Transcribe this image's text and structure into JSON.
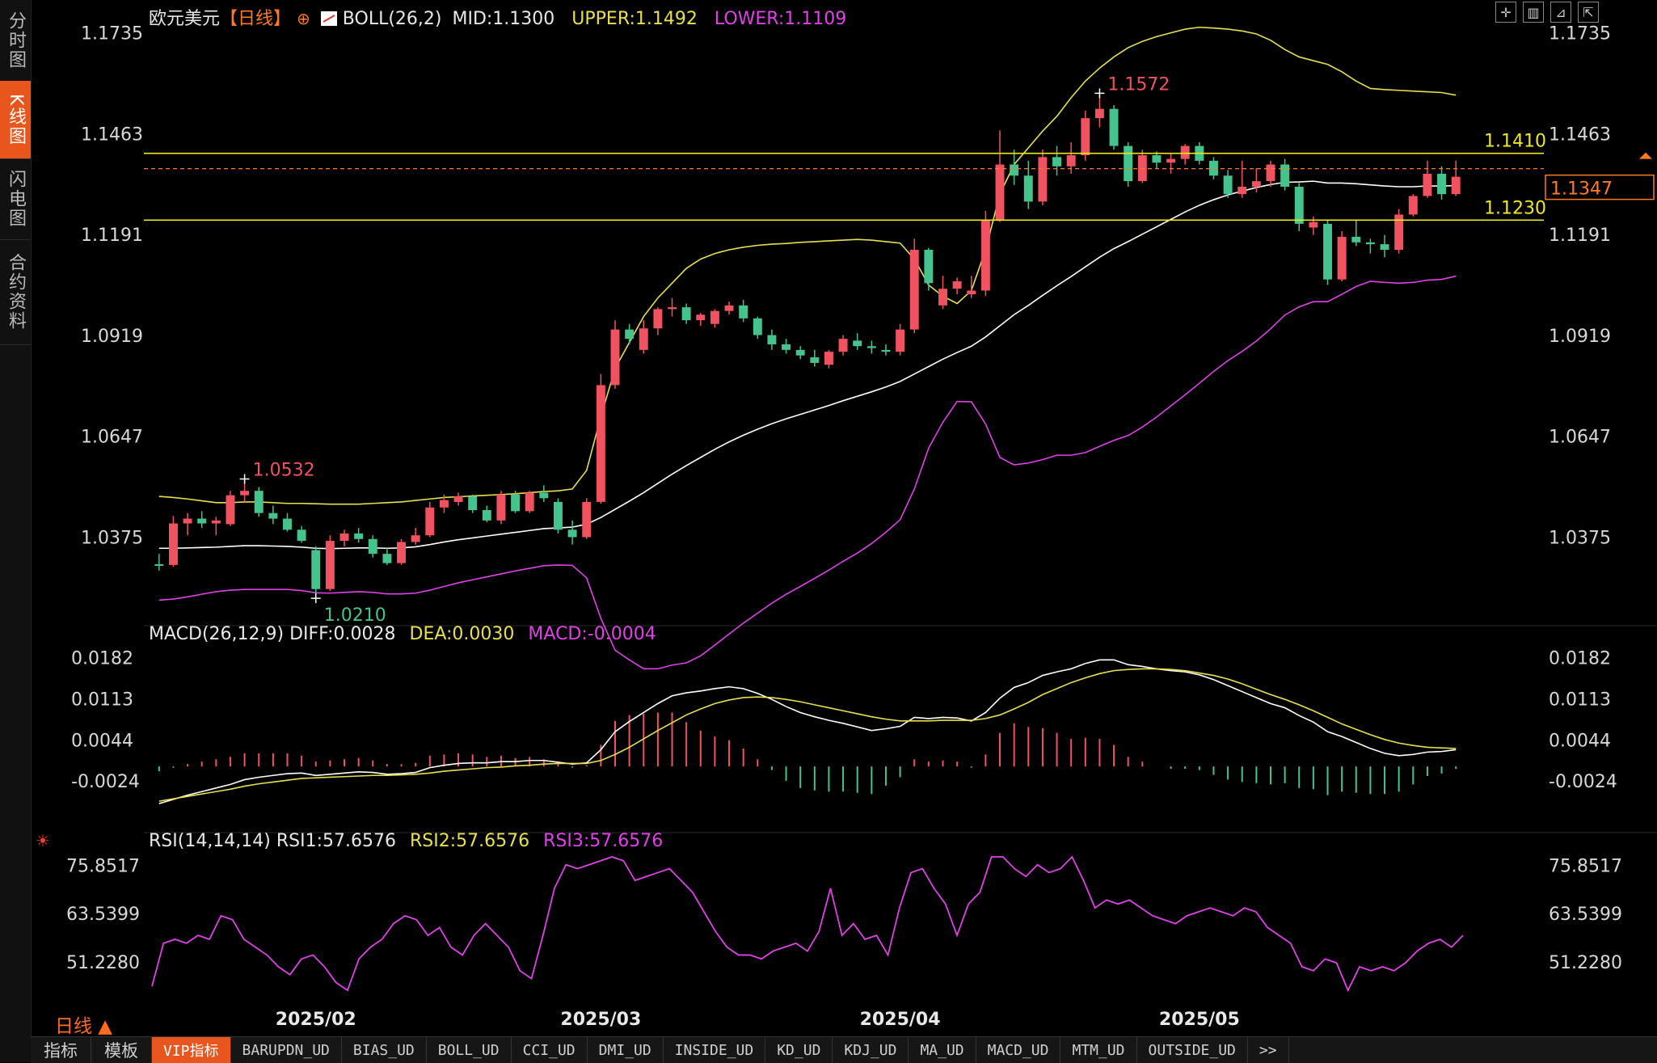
{
  "left_tabs": [
    {
      "label": "分时图",
      "active": false
    },
    {
      "label": "K线图",
      "active": true
    },
    {
      "label": "闪电图",
      "active": false
    },
    {
      "label": "合约资料",
      "active": false
    }
  ],
  "header": {
    "symbol": "欧元美元",
    "period_tag": "【日线】",
    "boll": {
      "name": "BOLL(26,2)",
      "mid": "MID:1.1300",
      "upper": "UPPER:1.1492",
      "lower": "LOWER:1.1109"
    },
    "toolbar_icons": [
      "crosshair-icon",
      "bar-chart-icon",
      "line-chart-icon",
      "expand-icon"
    ]
  },
  "macd_header": {
    "name": "MACD(26,12,9)",
    "diff": "DIFF:0.0028",
    "dea": "DEA:0.0030",
    "macd": "MACD:-0.0004"
  },
  "rsi_header": {
    "name": "RSI(14,14,14)",
    "rsi1": "RSI1:57.6576",
    "rsi2": "RSI2:57.6576",
    "rsi3": "RSI3:57.6576"
  },
  "colors": {
    "up": "#f0525f",
    "down": "#45c38c",
    "boll_mid": "#ffffff",
    "boll_upper": "#e8e04a",
    "boll_lower": "#e040e8",
    "price_line": "#ff7a1e",
    "level": "#f0e81e"
  },
  "chart_data": {
    "type": "candlestick",
    "title": "欧元美元 日线",
    "price_ticks": [
      "1.1735",
      "1.1463",
      "1.1191",
      "1.0919",
      "1.0647",
      "1.0375"
    ],
    "price_range": [
      1.0145,
      1.178
    ],
    "macd_ticks": [
      "0.0182",
      "0.0113",
      "0.0044",
      "-0.0024"
    ],
    "macd_range": [
      -0.007,
      0.02
    ],
    "rsi_ticks": [
      "75.8517",
      "63.5399",
      "51.2280"
    ],
    "rsi_range": [
      43,
      78
    ],
    "date_labels": [
      {
        "index": 11,
        "label": "2025/02"
      },
      {
        "index": 31,
        "label": "2025/03"
      },
      {
        "index": 52,
        "label": "2025/04"
      },
      {
        "index": 73,
        "label": "2025/05"
      }
    ],
    "annotations": [
      {
        "index": 6,
        "price": 1.0532,
        "label": "1.0532",
        "kind": "high"
      },
      {
        "index": 11,
        "price": 1.021,
        "label": "1.0210",
        "kind": "low"
      },
      {
        "index": 66,
        "price": 1.1572,
        "label": "1.1572",
        "kind": "high"
      }
    ],
    "levels": [
      {
        "price": 1.141,
        "label": "1.1410"
      },
      {
        "price": 1.123,
        "label": "1.1230"
      }
    ],
    "last_price": {
      "price": 1.1347,
      "label": "1.1347"
    },
    "candles": [
      [
        1.0302,
        1.033,
        1.0285,
        1.03
      ],
      [
        1.03,
        1.0432,
        1.0295,
        1.0412
      ],
      [
        1.0412,
        1.044,
        1.038,
        1.0425
      ],
      [
        1.0425,
        1.0445,
        1.04,
        1.0412
      ],
      [
        1.0412,
        1.043,
        1.038,
        1.042
      ],
      [
        1.041,
        1.05,
        1.0405,
        1.0488
      ],
      [
        1.0488,
        1.0532,
        1.047,
        1.05
      ],
      [
        1.05,
        1.051,
        1.043,
        1.044
      ],
      [
        1.044,
        1.046,
        1.041,
        1.0425
      ],
      [
        1.0425,
        1.044,
        1.039,
        1.0395
      ],
      [
        1.0395,
        1.0405,
        1.036,
        1.0365
      ],
      [
        1.034,
        1.035,
        1.021,
        1.0235
      ],
      [
        1.0235,
        1.038,
        1.023,
        1.0365
      ],
      [
        1.0365,
        1.0395,
        1.035,
        1.0385
      ],
      [
        1.0385,
        1.04,
        1.036,
        1.037
      ],
      [
        1.037,
        1.038,
        1.032,
        1.033
      ],
      [
        1.033,
        1.0345,
        1.03,
        1.0305
      ],
      [
        1.0305,
        1.037,
        1.03,
        1.0362
      ],
      [
        1.0362,
        1.04,
        1.0355,
        1.038
      ],
      [
        1.038,
        1.047,
        1.0375,
        1.0455
      ],
      [
        1.0455,
        1.049,
        1.044,
        1.0475
      ],
      [
        1.047,
        1.0495,
        1.046,
        1.0485
      ],
      [
        1.0485,
        1.049,
        1.044,
        1.0448
      ],
      [
        1.0448,
        1.046,
        1.0415,
        1.042
      ],
      [
        1.042,
        1.05,
        1.041,
        1.049
      ],
      [
        1.049,
        1.05,
        1.044,
        1.0445
      ],
      [
        1.0445,
        1.05,
        1.044,
        1.0495
      ],
      [
        1.0495,
        1.0515,
        1.047,
        1.048
      ],
      [
        1.047,
        1.048,
        1.0385,
        1.0395
      ],
      [
        1.0395,
        1.042,
        1.0355,
        1.0375
      ],
      [
        1.0375,
        1.048,
        1.037,
        1.047
      ],
      [
        1.047,
        1.0815,
        1.0465,
        1.0785
      ],
      [
        1.0785,
        1.096,
        1.0775,
        1.0935
      ],
      [
        1.0935,
        1.095,
        1.0895,
        1.091
      ],
      [
        1.088,
        1.096,
        1.087,
        1.0938
      ],
      [
        1.0938,
        1.0995,
        1.092,
        1.099
      ],
      [
        1.099,
        1.102,
        1.097,
        1.0995
      ],
      [
        1.0995,
        1.1005,
        1.095,
        1.096
      ],
      [
        1.096,
        1.098,
        1.0945,
        1.0975
      ],
      [
        1.095,
        1.099,
        1.094,
        1.0985
      ],
      [
        1.0985,
        1.101,
        1.0975,
        1.1
      ],
      [
        1.1,
        1.1015,
        1.0955,
        1.0965
      ],
      [
        1.0965,
        1.097,
        1.091,
        1.092
      ],
      [
        1.092,
        1.0935,
        1.088,
        1.0895
      ],
      [
        1.0895,
        1.091,
        1.087,
        1.088
      ],
      [
        1.088,
        1.089,
        1.0855,
        1.0865
      ],
      [
        1.086,
        1.088,
        1.0835,
        1.0845
      ],
      [
        1.084,
        1.088,
        1.083,
        1.0875
      ],
      [
        1.0875,
        1.092,
        1.0865,
        1.091
      ],
      [
        1.0905,
        1.0925,
        1.088,
        1.089
      ],
      [
        1.089,
        1.0905,
        1.087,
        1.0885
      ],
      [
        1.088,
        1.0895,
        1.0865,
        1.0875
      ],
      [
        1.0875,
        1.095,
        1.0865,
        1.0935
      ],
      [
        1.0935,
        1.118,
        1.0925,
        1.115
      ],
      [
        1.115,
        1.1155,
        1.104,
        1.106
      ],
      [
        1.1,
        1.108,
        1.099,
        1.1045
      ],
      [
        1.1045,
        1.1075,
        1.103,
        1.1065
      ],
      [
        1.103,
        1.108,
        1.102,
        1.104
      ],
      [
        1.104,
        1.1255,
        1.1025,
        1.123
      ],
      [
        1.123,
        1.1472,
        1.1225,
        1.138
      ],
      [
        1.138,
        1.142,
        1.1325,
        1.135
      ],
      [
        1.135,
        1.139,
        1.126,
        1.128
      ],
      [
        1.128,
        1.142,
        1.127,
        1.14
      ],
      [
        1.14,
        1.143,
        1.135,
        1.1375
      ],
      [
        1.1375,
        1.144,
        1.1355,
        1.1405
      ],
      [
        1.1405,
        1.1525,
        1.139,
        1.1505
      ],
      [
        1.1505,
        1.1572,
        1.148,
        1.153
      ],
      [
        1.153,
        1.154,
        1.142,
        1.143
      ],
      [
        1.143,
        1.144,
        1.132,
        1.1335
      ],
      [
        1.1335,
        1.142,
        1.133,
        1.1405
      ],
      [
        1.1405,
        1.1415,
        1.137,
        1.1385
      ],
      [
        1.1385,
        1.141,
        1.1355,
        1.1395
      ],
      [
        1.1395,
        1.1435,
        1.138,
        1.143
      ],
      [
        1.143,
        1.144,
        1.138,
        1.139
      ],
      [
        1.139,
        1.14,
        1.134,
        1.135
      ],
      [
        1.135,
        1.1365,
        1.129,
        1.13
      ],
      [
        1.13,
        1.139,
        1.129,
        1.132
      ],
      [
        1.132,
        1.137,
        1.1305,
        1.1335
      ],
      [
        1.1335,
        1.139,
        1.132,
        1.138
      ],
      [
        1.138,
        1.1395,
        1.131,
        1.132
      ],
      [
        1.132,
        1.133,
        1.12,
        1.122
      ],
      [
        1.121,
        1.124,
        1.119,
        1.1225
      ],
      [
        1.122,
        1.123,
        1.1055,
        1.107
      ],
      [
        1.107,
        1.12,
        1.1065,
        1.1185
      ],
      [
        1.1185,
        1.123,
        1.116,
        1.117
      ],
      [
        1.117,
        1.118,
        1.114,
        1.1165
      ],
      [
        1.1165,
        1.119,
        1.113,
        1.115
      ],
      [
        1.115,
        1.126,
        1.114,
        1.1245
      ],
      [
        1.1245,
        1.13,
        1.124,
        1.1295
      ],
      [
        1.1295,
        1.139,
        1.129,
        1.1355
      ],
      [
        1.1355,
        1.1375,
        1.1285,
        1.13
      ],
      [
        1.13,
        1.139,
        1.1295,
        1.1347
      ]
    ],
    "boll_mid": [
      1.0345,
      1.0345,
      1.0346,
      1.0347,
      1.0348,
      1.035,
      1.0352,
      1.0352,
      1.0351,
      1.035,
      1.0348,
      1.0345,
      1.0344,
      1.0345,
      1.0346,
      1.0346,
      1.0345,
      1.0346,
      1.0349,
      1.0355,
      1.0362,
      1.0368,
      1.0373,
      1.0378,
      1.0383,
      1.0388,
      1.0393,
      1.0398,
      1.04,
      1.0402,
      1.041,
      1.0428,
      1.045,
      1.0472,
      1.0495,
      1.052,
      1.0545,
      1.0568,
      1.059,
      1.0612,
      1.0632,
      1.065,
      1.0666,
      1.0681,
      1.0694,
      1.0706,
      1.0718,
      1.073,
      1.0743,
      1.0755,
      1.0767,
      1.078,
      1.0795,
      1.0815,
      1.0835,
      1.0855,
      1.0873,
      1.089,
      1.0915,
      1.0945,
      1.0975,
      1.1,
      1.1027,
      1.1053,
      1.1078,
      1.1104,
      1.113,
      1.1153,
      1.1172,
      1.1192,
      1.1212,
      1.1232,
      1.1252,
      1.127,
      1.1285,
      1.1298,
      1.1308,
      1.1318,
      1.1326,
      1.1332,
      1.1333,
      1.1335,
      1.133,
      1.133,
      1.1328,
      1.1325,
      1.1322,
      1.132,
      1.132,
      1.1322,
      1.1322,
      1.1323
    ],
    "boll_upper": [
      1.0485,
      1.0482,
      1.0478,
      1.0473,
      1.0468,
      1.0468,
      1.047,
      1.047,
      1.0468,
      1.0466,
      1.0466,
      1.0465,
      1.0464,
      1.0464,
      1.0464,
      1.0466,
      1.0468,
      1.047,
      1.0474,
      1.0478,
      1.0482,
      1.0484,
      1.0486,
      1.0488,
      1.049,
      1.0492,
      1.0495,
      1.0498,
      1.05,
      1.0505,
      1.0555,
      1.07,
      1.083,
      1.09,
      1.097,
      1.102,
      1.106,
      1.11,
      1.1125,
      1.114,
      1.115,
      1.1157,
      1.1162,
      1.1165,
      1.1167,
      1.117,
      1.1172,
      1.1174,
      1.1176,
      1.1178,
      1.1176,
      1.1172,
      1.1168,
      1.1125,
      1.1055,
      1.1025,
      1.1005,
      1.104,
      1.115,
      1.13,
      1.138,
      1.1425,
      1.147,
      1.151,
      1.156,
      1.1605,
      1.164,
      1.167,
      1.1695,
      1.1712,
      1.1725,
      1.1735,
      1.1745,
      1.175,
      1.1748,
      1.1745,
      1.174,
      1.1732,
      1.1715,
      1.169,
      1.167,
      1.166,
      1.165,
      1.163,
      1.1605,
      1.1585,
      1.1582,
      1.158,
      1.1578,
      1.1576,
      1.1574,
      1.1567
    ],
    "boll_lower": [
      1.0205,
      1.0208,
      1.0214,
      1.0221,
      1.0228,
      1.0232,
      1.0234,
      1.0234,
      1.0234,
      1.0234,
      1.0231,
      1.0225,
      1.0224,
      1.0226,
      1.0228,
      1.0226,
      1.0222,
      1.0222,
      1.0224,
      1.0232,
      1.0242,
      1.0252,
      1.026,
      1.0268,
      1.0276,
      1.0284,
      1.0291,
      1.0298,
      1.03,
      1.0299,
      1.0265,
      1.0156,
      1.007,
      1.0044,
      1.002,
      1.002,
      1.003,
      1.0036,
      1.0055,
      1.0084,
      1.0114,
      1.0143,
      1.017,
      1.0197,
      1.0221,
      1.0242,
      1.0264,
      1.0286,
      1.031,
      1.0332,
      1.0358,
      1.0388,
      1.0422,
      1.0505,
      1.0615,
      1.0685,
      1.0741,
      1.074,
      1.068,
      1.059,
      1.057,
      1.0575,
      1.0584,
      1.0596,
      1.0596,
      1.0603,
      1.062,
      1.0636,
      1.0649,
      1.0672,
      1.0699,
      1.0729,
      1.0759,
      1.079,
      1.0822,
      1.0851,
      1.0876,
      1.0904,
      1.0937,
      1.0974,
      1.0996,
      1.101,
      1.101,
      1.103,
      1.1051,
      1.1065,
      1.1062,
      1.106,
      1.1062,
      1.1068,
      1.107,
      1.1079
    ],
    "macd_diff": [
      -0.0062,
      -0.0055,
      -0.0048,
      -0.0042,
      -0.0036,
      -0.003,
      -0.0022,
      -0.0018,
      -0.0015,
      -0.0012,
      -0.0011,
      -0.0015,
      -0.0013,
      -0.0011,
      -0.0009,
      -0.001,
      -0.0013,
      -0.0012,
      -0.001,
      -0.0002,
      0.0002,
      0.0005,
      0.0006,
      0.0006,
      0.0008,
      0.0008,
      0.001,
      0.001,
      0.0007,
      0.0004,
      0.0006,
      0.0028,
      0.0058,
      0.0075,
      0.009,
      0.0105,
      0.0118,
      0.0123,
      0.0126,
      0.013,
      0.0133,
      0.013,
      0.0122,
      0.0112,
      0.01,
      0.009,
      0.0083,
      0.0077,
      0.0072,
      0.0066,
      0.006,
      0.0063,
      0.0067,
      0.0082,
      0.008,
      0.0082,
      0.0081,
      0.0076,
      0.009,
      0.0114,
      0.0132,
      0.014,
      0.0152,
      0.0158,
      0.0163,
      0.0172,
      0.0178,
      0.0178,
      0.017,
      0.0167,
      0.0163,
      0.016,
      0.0158,
      0.0153,
      0.0145,
      0.0135,
      0.0125,
      0.0115,
      0.0105,
      0.0098,
      0.0085,
      0.0074,
      0.0058,
      0.005,
      0.004,
      0.003,
      0.0022,
      0.0018,
      0.002,
      0.0024,
      0.0025,
      0.0028
    ],
    "macd_dea": [
      -0.0058,
      -0.0054,
      -0.005,
      -0.0046,
      -0.0042,
      -0.0038,
      -0.0033,
      -0.0029,
      -0.0026,
      -0.0023,
      -0.002,
      -0.0019,
      -0.0018,
      -0.0017,
      -0.0016,
      -0.0015,
      -0.0015,
      -0.0014,
      -0.0013,
      -0.0011,
      -0.0008,
      -0.0006,
      -0.0004,
      -0.0002,
      -0.0001,
      0.0001,
      0.0002,
      0.0004,
      0.0005,
      0.0005,
      0.0005,
      0.001,
      0.002,
      0.0032,
      0.0046,
      0.006,
      0.0073,
      0.0086,
      0.0096,
      0.0105,
      0.0111,
      0.0115,
      0.0116,
      0.0115,
      0.0112,
      0.0108,
      0.0103,
      0.0098,
      0.0093,
      0.0088,
      0.0083,
      0.0079,
      0.0076,
      0.0076,
      0.0076,
      0.0077,
      0.0077,
      0.0077,
      0.008,
      0.0086,
      0.0096,
      0.0107,
      0.012,
      0.013,
      0.014,
      0.0148,
      0.0155,
      0.016,
      0.0162,
      0.0163,
      0.0163,
      0.0162,
      0.016,
      0.0156,
      0.0152,
      0.0146,
      0.0138,
      0.0129,
      0.012,
      0.0112,
      0.0103,
      0.0093,
      0.0082,
      0.0071,
      0.0062,
      0.0053,
      0.0045,
      0.0039,
      0.0035,
      0.0032,
      0.0031,
      0.003
    ]
  },
  "rsi": [
    45,
    56,
    57,
    56,
    58,
    57,
    63,
    62,
    57,
    55,
    53,
    50,
    48,
    52,
    53,
    50,
    46,
    44,
    52,
    55,
    57,
    61,
    63,
    62,
    58,
    60,
    55,
    53,
    58,
    61,
    58,
    55,
    49,
    47,
    58,
    70,
    76,
    75,
    76,
    77,
    78,
    77,
    72,
    73,
    74,
    75,
    72,
    69,
    64,
    59,
    55,
    53,
    53,
    52,
    54,
    55,
    56,
    54,
    59,
    70,
    58,
    61,
    57,
    58,
    53,
    65,
    74,
    75,
    70,
    66,
    58,
    66,
    69,
    78,
    78,
    75,
    73,
    76,
    74,
    75,
    78,
    72,
    65,
    67,
    66,
    67,
    65,
    63,
    62,
    61,
    63,
    64,
    65,
    64,
    63,
    65,
    64,
    60,
    58,
    56,
    50,
    49,
    52,
    51,
    44,
    50,
    49,
    50,
    49,
    51,
    54,
    56,
    57,
    55,
    58
  ],
  "axis_labels_bottom": [
    "2025/02",
    "2025/03",
    "2025/04",
    "2025/05"
  ],
  "period_label": "日线 ▲",
  "bottom_tabs": [
    {
      "label": "指标",
      "active": false,
      "cn": true
    },
    {
      "label": "模板",
      "active": false,
      "cn": true
    },
    {
      "label": "VIP指标",
      "active": true,
      "cn": false
    },
    {
      "label": "BARUPDN_UD",
      "active": false,
      "cn": false
    },
    {
      "label": "BIAS_UD",
      "active": false,
      "cn": false
    },
    {
      "label": "BOLL_UD",
      "active": false,
      "cn": false
    },
    {
      "label": "CCI_UD",
      "active": false,
      "cn": false
    },
    {
      "label": "DMI_UD",
      "active": false,
      "cn": false
    },
    {
      "label": "INSIDE_UD",
      "active": false,
      "cn": false
    },
    {
      "label": "KD_UD",
      "active": false,
      "cn": false
    },
    {
      "label": "KDJ_UD",
      "active": false,
      "cn": false
    },
    {
      "label": "MA_UD",
      "active": false,
      "cn": false
    },
    {
      "label": "MACD_UD",
      "active": false,
      "cn": false
    },
    {
      "label": "MTM_UD",
      "active": false,
      "cn": false
    },
    {
      "label": "OUTSIDE_UD",
      "active": false,
      "cn": false
    },
    {
      "label": ">>",
      "active": false,
      "cn": false
    }
  ]
}
